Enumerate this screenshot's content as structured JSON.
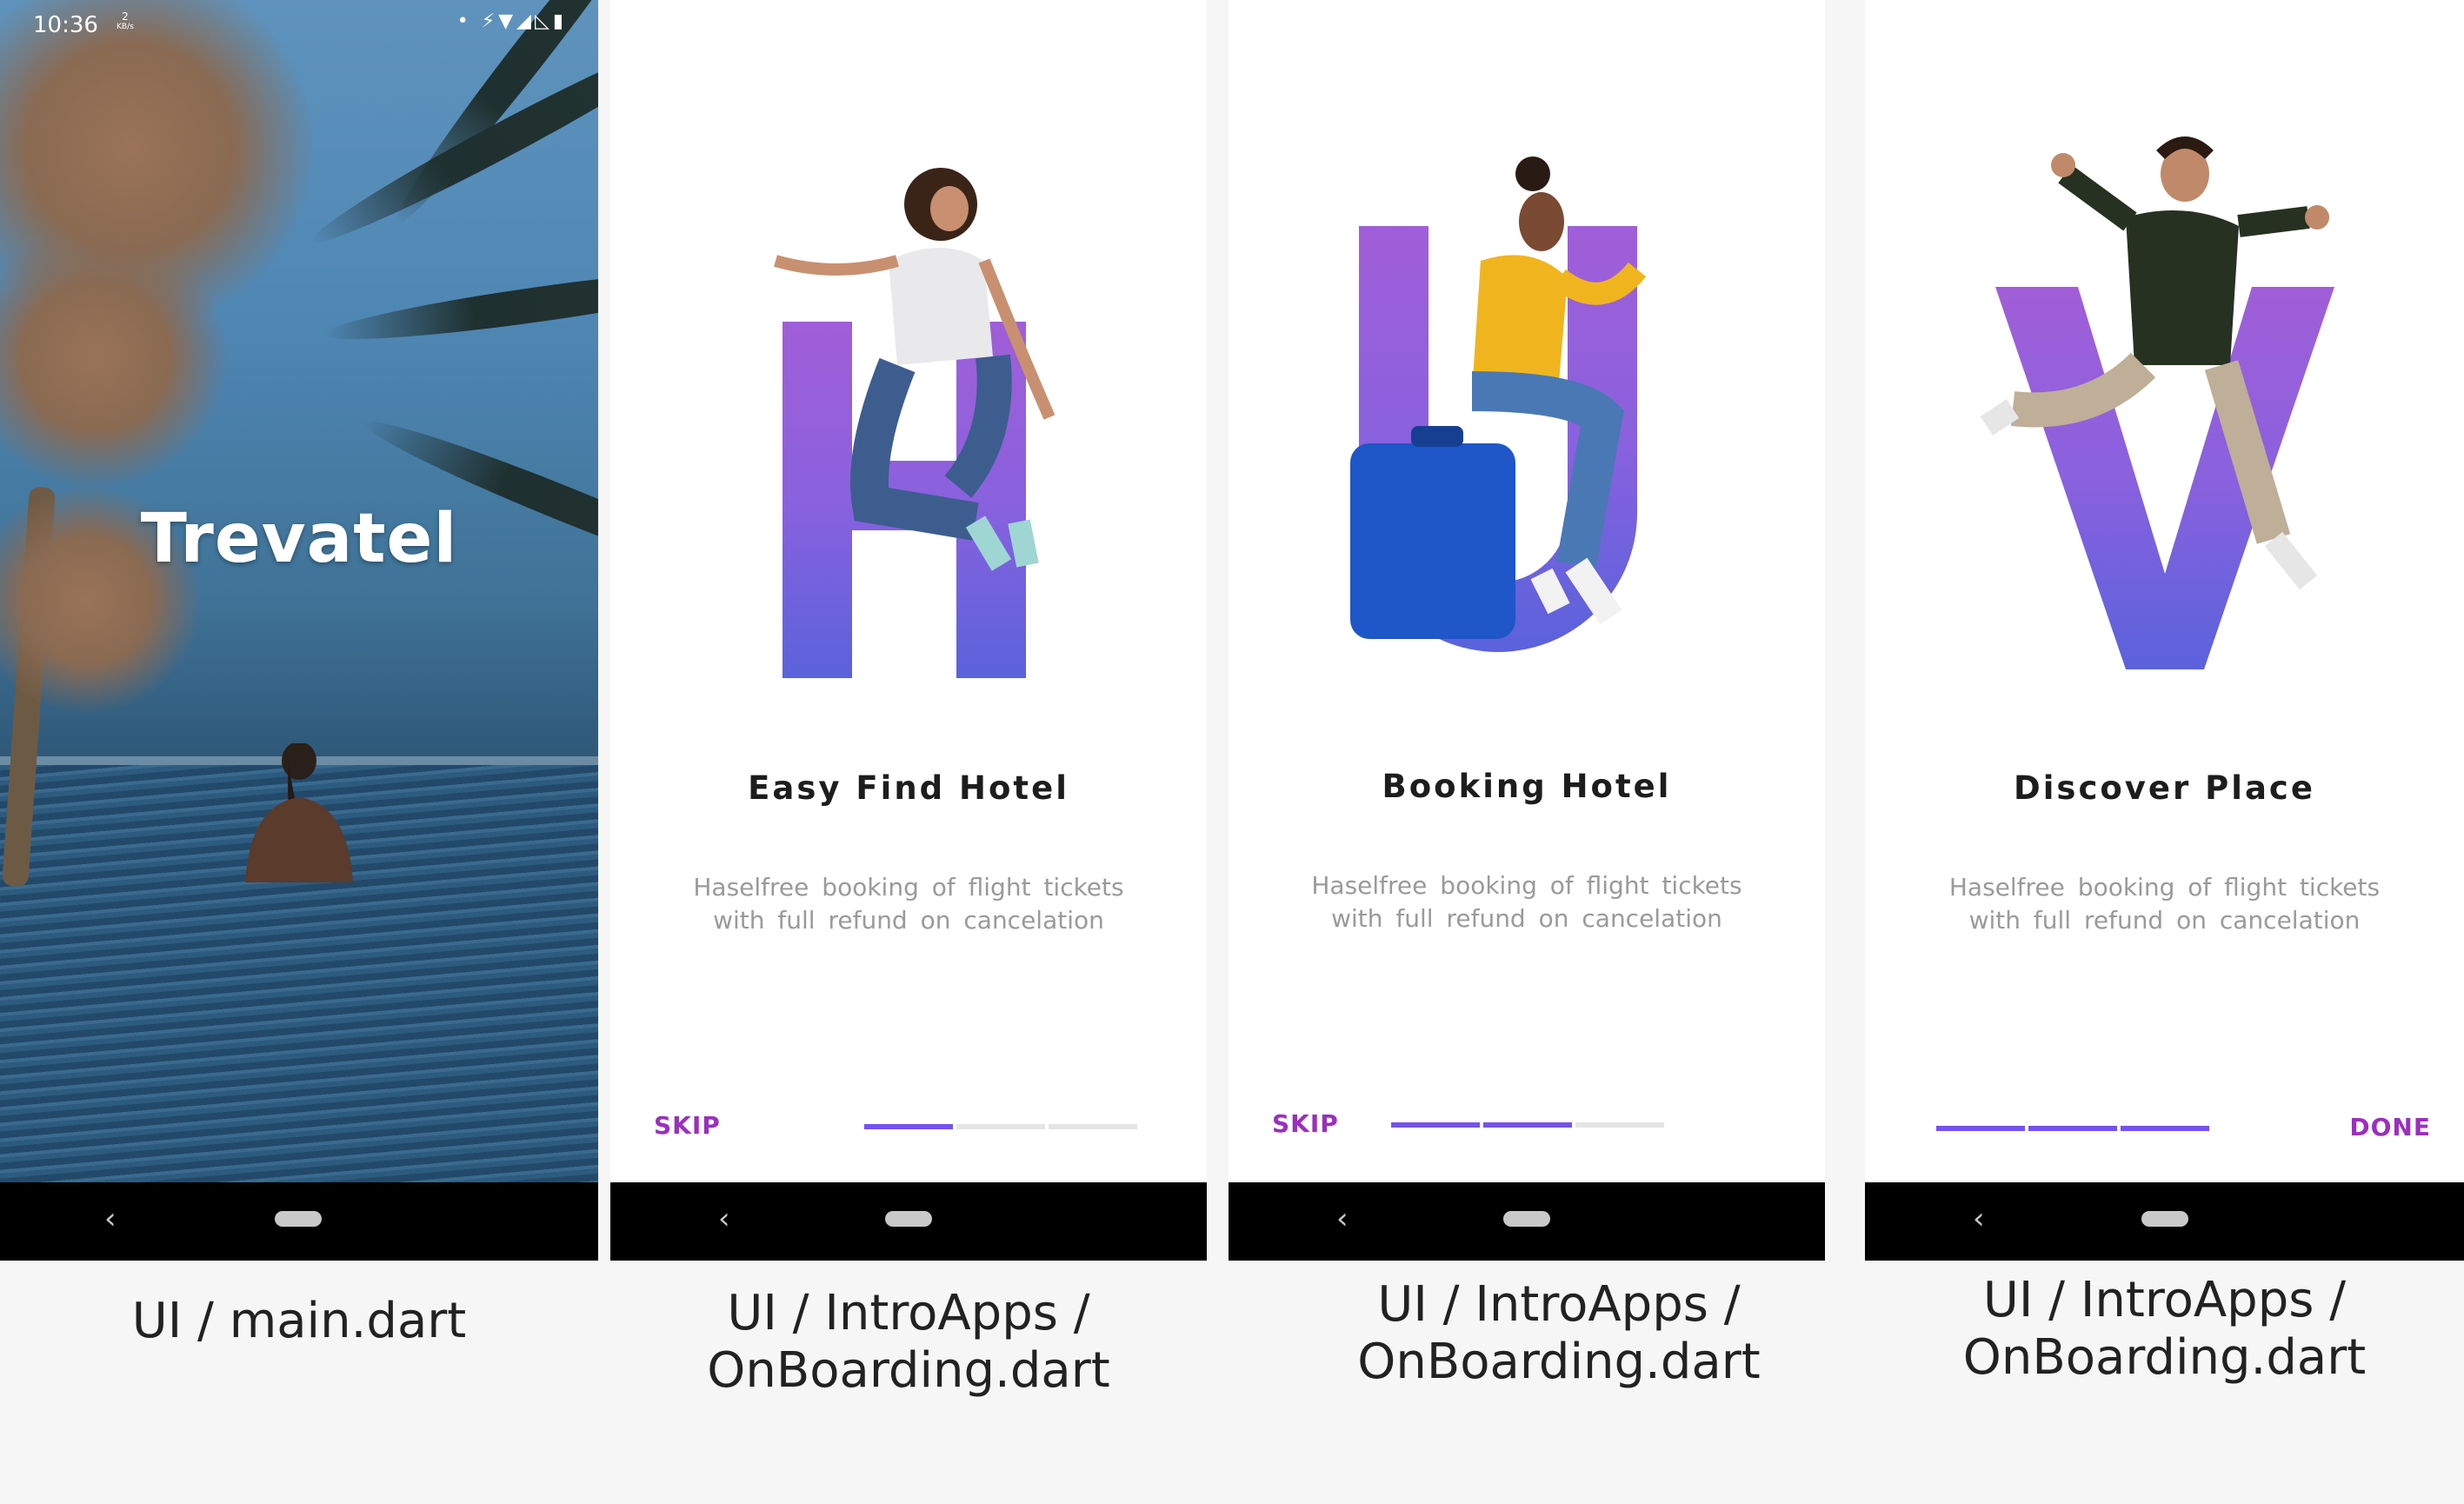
{
  "accent_color": "#7452f0",
  "button_color": "#9b2fbf",
  "splash": {
    "status_time": "10:36",
    "status_speed_value": "2",
    "status_speed_unit": "KB/s",
    "status_icons": "• ⚡▼◢◺▮",
    "title": "Trevatel",
    "nav_back_icon": "‹"
  },
  "screens": [
    {
      "letter": "H",
      "title": "Easy Find Hotel",
      "desc_line1": "Haselfree booking of flight tickets",
      "desc_line2": "with full refund on cancelation",
      "button": "SKIP",
      "progress": {
        "active_segments": 1,
        "total_segments": 3
      },
      "nav_back_icon": "‹"
    },
    {
      "letter": "U",
      "title": "Booking Hotel",
      "desc_line1": "Haselfree booking of flight tickets",
      "desc_line2": "with full refund on cancelation",
      "button": "SKIP",
      "progress": {
        "active_segments": 2,
        "total_segments": 3
      },
      "nav_back_icon": "‹"
    },
    {
      "letter": "V",
      "title": "Discover Place",
      "desc_line1": "Haselfree booking of flight tickets",
      "desc_line2": "with full refund on cancelation",
      "button": "DONE",
      "progress": {
        "active_segments": 3,
        "total_segments": 3
      },
      "nav_back_icon": "‹"
    }
  ],
  "captions": [
    {
      "line1": "UI / main.dart",
      "line2": ""
    },
    {
      "line1": "UI / IntroApps /",
      "line2": "OnBoarding.dart"
    },
    {
      "line1": "UI / IntroApps /",
      "line2": "OnBoarding.dart"
    },
    {
      "line1": "UI / IntroApps /",
      "line2": "OnBoarding.dart"
    }
  ]
}
